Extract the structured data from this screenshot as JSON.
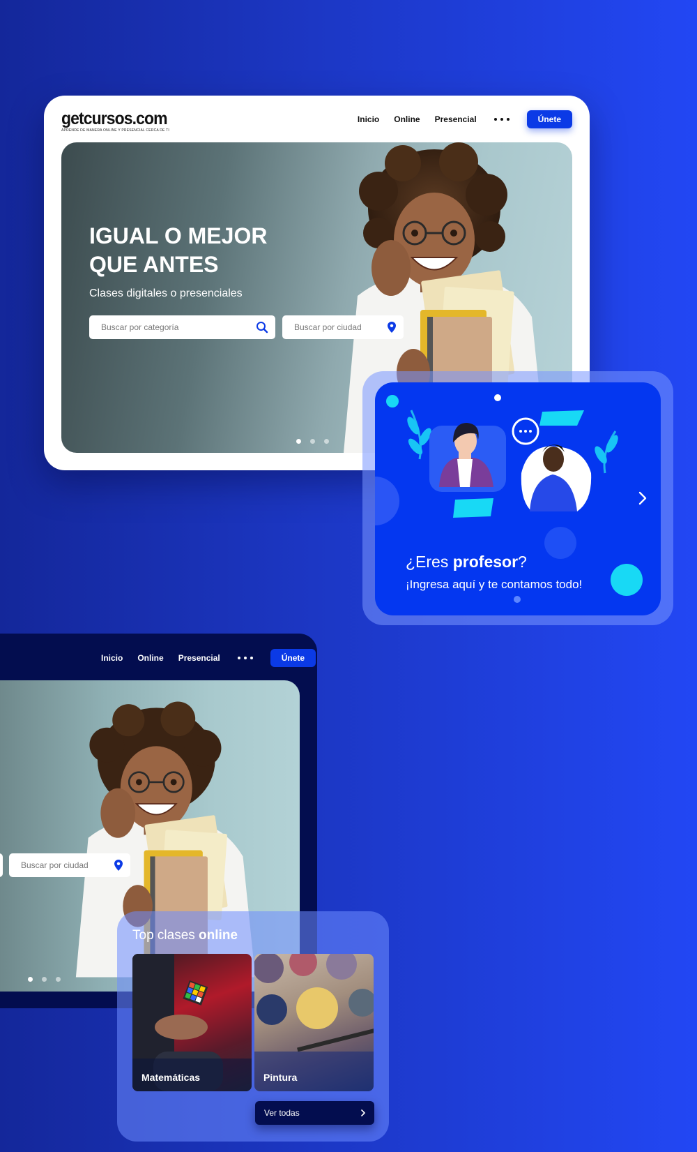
{
  "site": {
    "logo": "getcursos.com",
    "tagline": "APRENDE DE MANERA ONLINE Y PRESENCIAL CERCA DE TI"
  },
  "nav": {
    "items": [
      "Inicio",
      "Online",
      "Presencial"
    ],
    "join_label": "Únete"
  },
  "hero": {
    "title_line1": "IGUAL O MEJOR",
    "title_line2": "QUE ANTES",
    "subtitle": "Clases digitales o presenciales",
    "category_placeholder": "Buscar por categoría",
    "city_placeholder": "Buscar por ciudad",
    "slides": 3,
    "active_slide": 1
  },
  "teacher_card": {
    "question_prefix": "¿Eres ",
    "question_bold": "profesor",
    "question_suffix": "?",
    "subtitle": "¡Ingresa aquí y te contamos todo!"
  },
  "top_classes": {
    "title_prefix": "Top clases ",
    "title_bold": "online",
    "items": [
      {
        "label": "Matemáticas"
      },
      {
        "label": "Pintura"
      }
    ],
    "see_all": "Ver todas"
  },
  "colors": {
    "brand_blue": "#0b3ae6",
    "dark_navy": "#030d4f",
    "accent_cyan": "#18d9f5"
  }
}
